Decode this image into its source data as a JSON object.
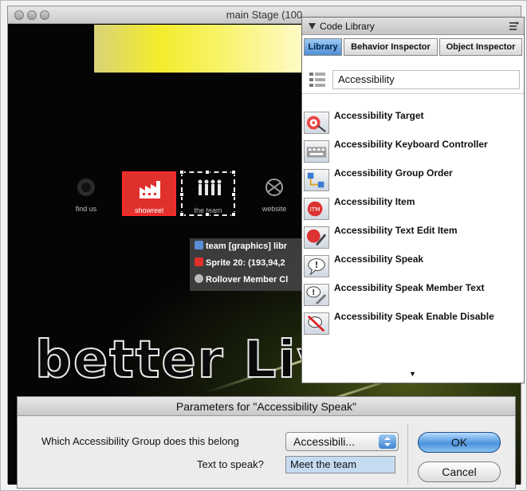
{
  "stage": {
    "title": "main Stage (100",
    "nav": {
      "find_us": "find us",
      "showreel": "showreel",
      "the_team": "the team",
      "website": "website"
    },
    "sprite_tip": {
      "row1": "team [graphics] libr",
      "row2": "Sprite 20: (193,94,2",
      "row3": "Rollover Member Cl"
    },
    "better_text": "better Liv"
  },
  "code_library": {
    "title": "Code Library",
    "tabs": [
      "Library",
      "Behavior Inspector",
      "Object Inspector"
    ],
    "active_tab": "Library",
    "category": "Accessibility",
    "items": [
      "Accessibility Target",
      "Accessibility Keyboard Controller",
      "Accessibility Group Order",
      "Accessibility Item",
      "Accessibility Text Edit Item",
      "Accessibility Speak",
      "Accessibility Speak Member Text",
      "Accessibility Speak Enable Disable"
    ]
  },
  "params_dialog": {
    "title": "Parameters for \"Accessibility Speak\"",
    "group_label": "Which Accessibility Group does this belong",
    "group_value": "Accessibili...",
    "text_label": "Text to speak?",
    "text_value": "Meet the team",
    "ok_label": "OK",
    "cancel_label": "Cancel"
  },
  "colors": {
    "selection_red": "#e0302c",
    "active_tab_blue": "#4f8fd4",
    "ok_button_blue": "#4b93de"
  }
}
